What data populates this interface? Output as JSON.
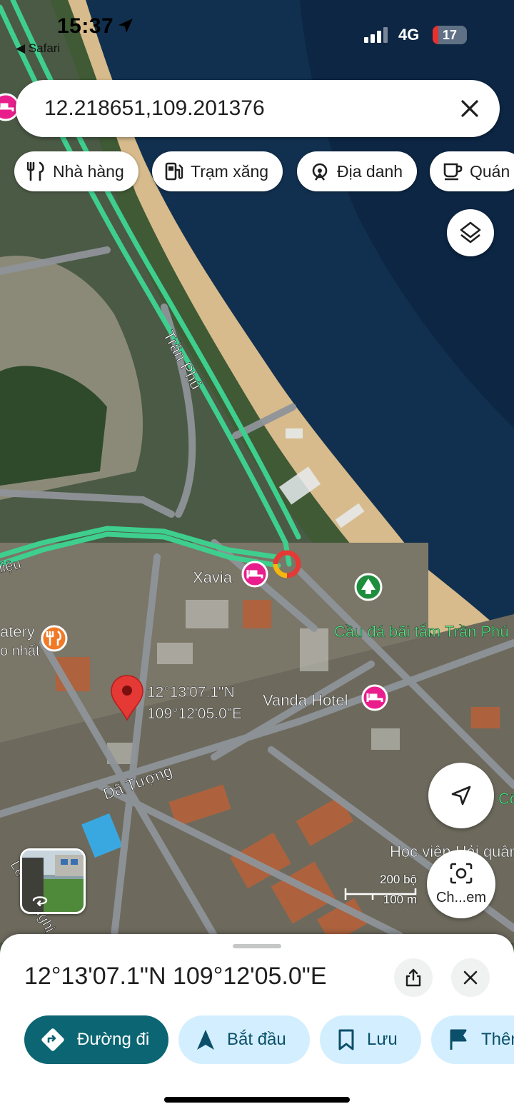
{
  "status_bar": {
    "time": "15:37",
    "back_app": "◀ Safari",
    "network": "4G",
    "battery": "17",
    "battery_level_percent": 17
  },
  "search": {
    "query": "12.218651,109.201376"
  },
  "category_chips": [
    {
      "label": "Nhà hàng",
      "icon": "restaurant-icon"
    },
    {
      "label": "Trạm xăng",
      "icon": "gas-station-icon"
    },
    {
      "label": "Địa danh",
      "icon": "landmark-icon"
    },
    {
      "label": "Quán",
      "icon": "cafe-icon"
    }
  ],
  "map": {
    "labels": {
      "tran_phu": "Trần Phú",
      "xavia": "Xavia",
      "beach_place": "Cầu đá bãi tắm Trần Phú",
      "vanda": "Vanda Hotel",
      "da_tuong": "Dã Tượng",
      "hoc_vien": "Học viện Hải quân",
      "lieu": "liệu",
      "catery": "atery",
      "catery_sub": "o nhất",
      "le_nghi": "Lê Văn Nghị",
      "co": "Cô",
      "pin_line1": "12°13'07.1\"N",
      "pin_line2": "109°12'05.0\"E"
    },
    "scale": {
      "imperial": "200 bộ",
      "metric": "100 m"
    }
  },
  "lens_button_label": "Ch...em",
  "place_sheet": {
    "title": "12°13'07.1\"N 109°12'05.0\"E",
    "actions": [
      {
        "label": "Đường đi",
        "icon": "directions-icon"
      },
      {
        "label": "Bắt đầu",
        "icon": "navigation-arrow-icon"
      },
      {
        "label": "Lưu",
        "icon": "bookmark-icon"
      },
      {
        "label": "Thêm",
        "icon": "flag-icon"
      }
    ]
  },
  "colors": {
    "sea": "#0f2c4e",
    "beach": "#d6b98a",
    "route_green": "#3ecf8e",
    "primary_button": "#0b6573",
    "tonal_button": "#d3efff",
    "pin_red": "#e53935",
    "poi_pink": "#e91e8c",
    "park_green": "#1e8e3e"
  }
}
